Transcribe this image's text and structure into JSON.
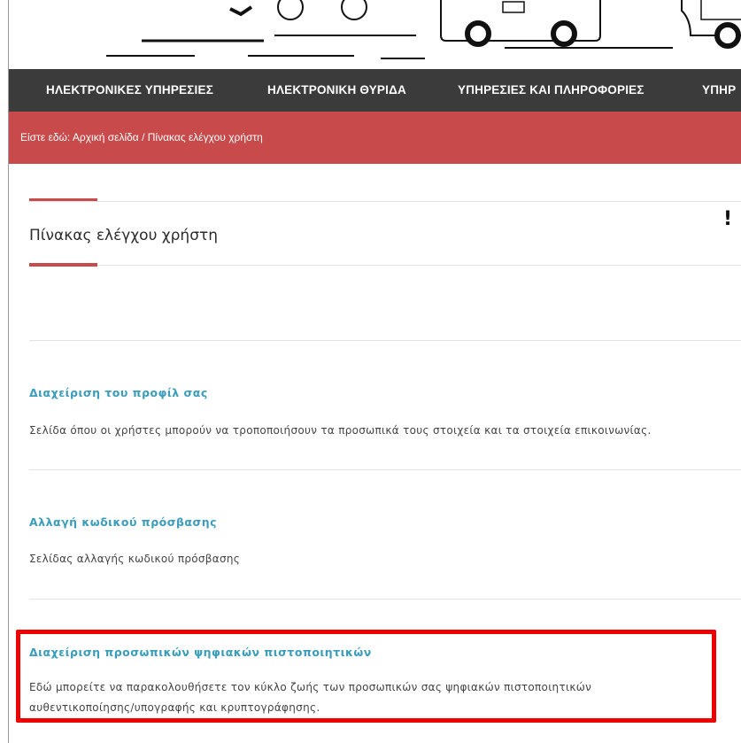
{
  "nav": {
    "items": [
      {
        "label": "ΗΛΕΚΤΡΟΝΙΚΕΣ ΥΠΗΡΕΣΙΕΣ"
      },
      {
        "label": "ΗΛΕΚΤΡΟΝΙΚΗ ΘΥΡΙΔΑ"
      },
      {
        "label": "ΥΠΗΡΕΣΙΕΣ ΚΑΙ ΠΛΗΡΟΦΟΡΙΕΣ"
      },
      {
        "label": "ΥΠΗΡ"
      }
    ]
  },
  "breadcrumb": {
    "prefix": "Είστε εδώ: ",
    "home": "Αρχική σελίδα",
    "separator": " / ",
    "current": "Πίνακας ελέγχου χρήστη"
  },
  "page": {
    "title": "Πίνακας ελέγχου χρήστη",
    "alert_mark": "!"
  },
  "sections": [
    {
      "title": "Διαχείριση του προφίλ σας",
      "description": "Σελίδα όπου οι χρήστες μπορούν να τροποποιήσουν τα προσωπικά τους στοιχεία και τα στοιχεία επικοινωνίας."
    },
    {
      "title": "Αλλαγή κωδικού πρόσβασης",
      "description": "Σελίδας αλλαγής κωδικού πρόσβασης"
    },
    {
      "title": "Διαχείριση προσωπικών ψηφιακών πιστοποιητικών",
      "description_line1": "Εδώ μπορείτε να παρακολουθήσετε τον κύκλο ζωής των προσωπικών σας ψηφιακών πιστοποιητικών",
      "description_line2": "αυθεντικοποίησης/υπογραφής και κρυπτογράφησης."
    }
  ],
  "colors": {
    "nav_bg": "#3b3b3b",
    "brand_red": "#c94a4a",
    "link_blue": "#3a9dbb",
    "highlight_red": "#ee0000"
  }
}
